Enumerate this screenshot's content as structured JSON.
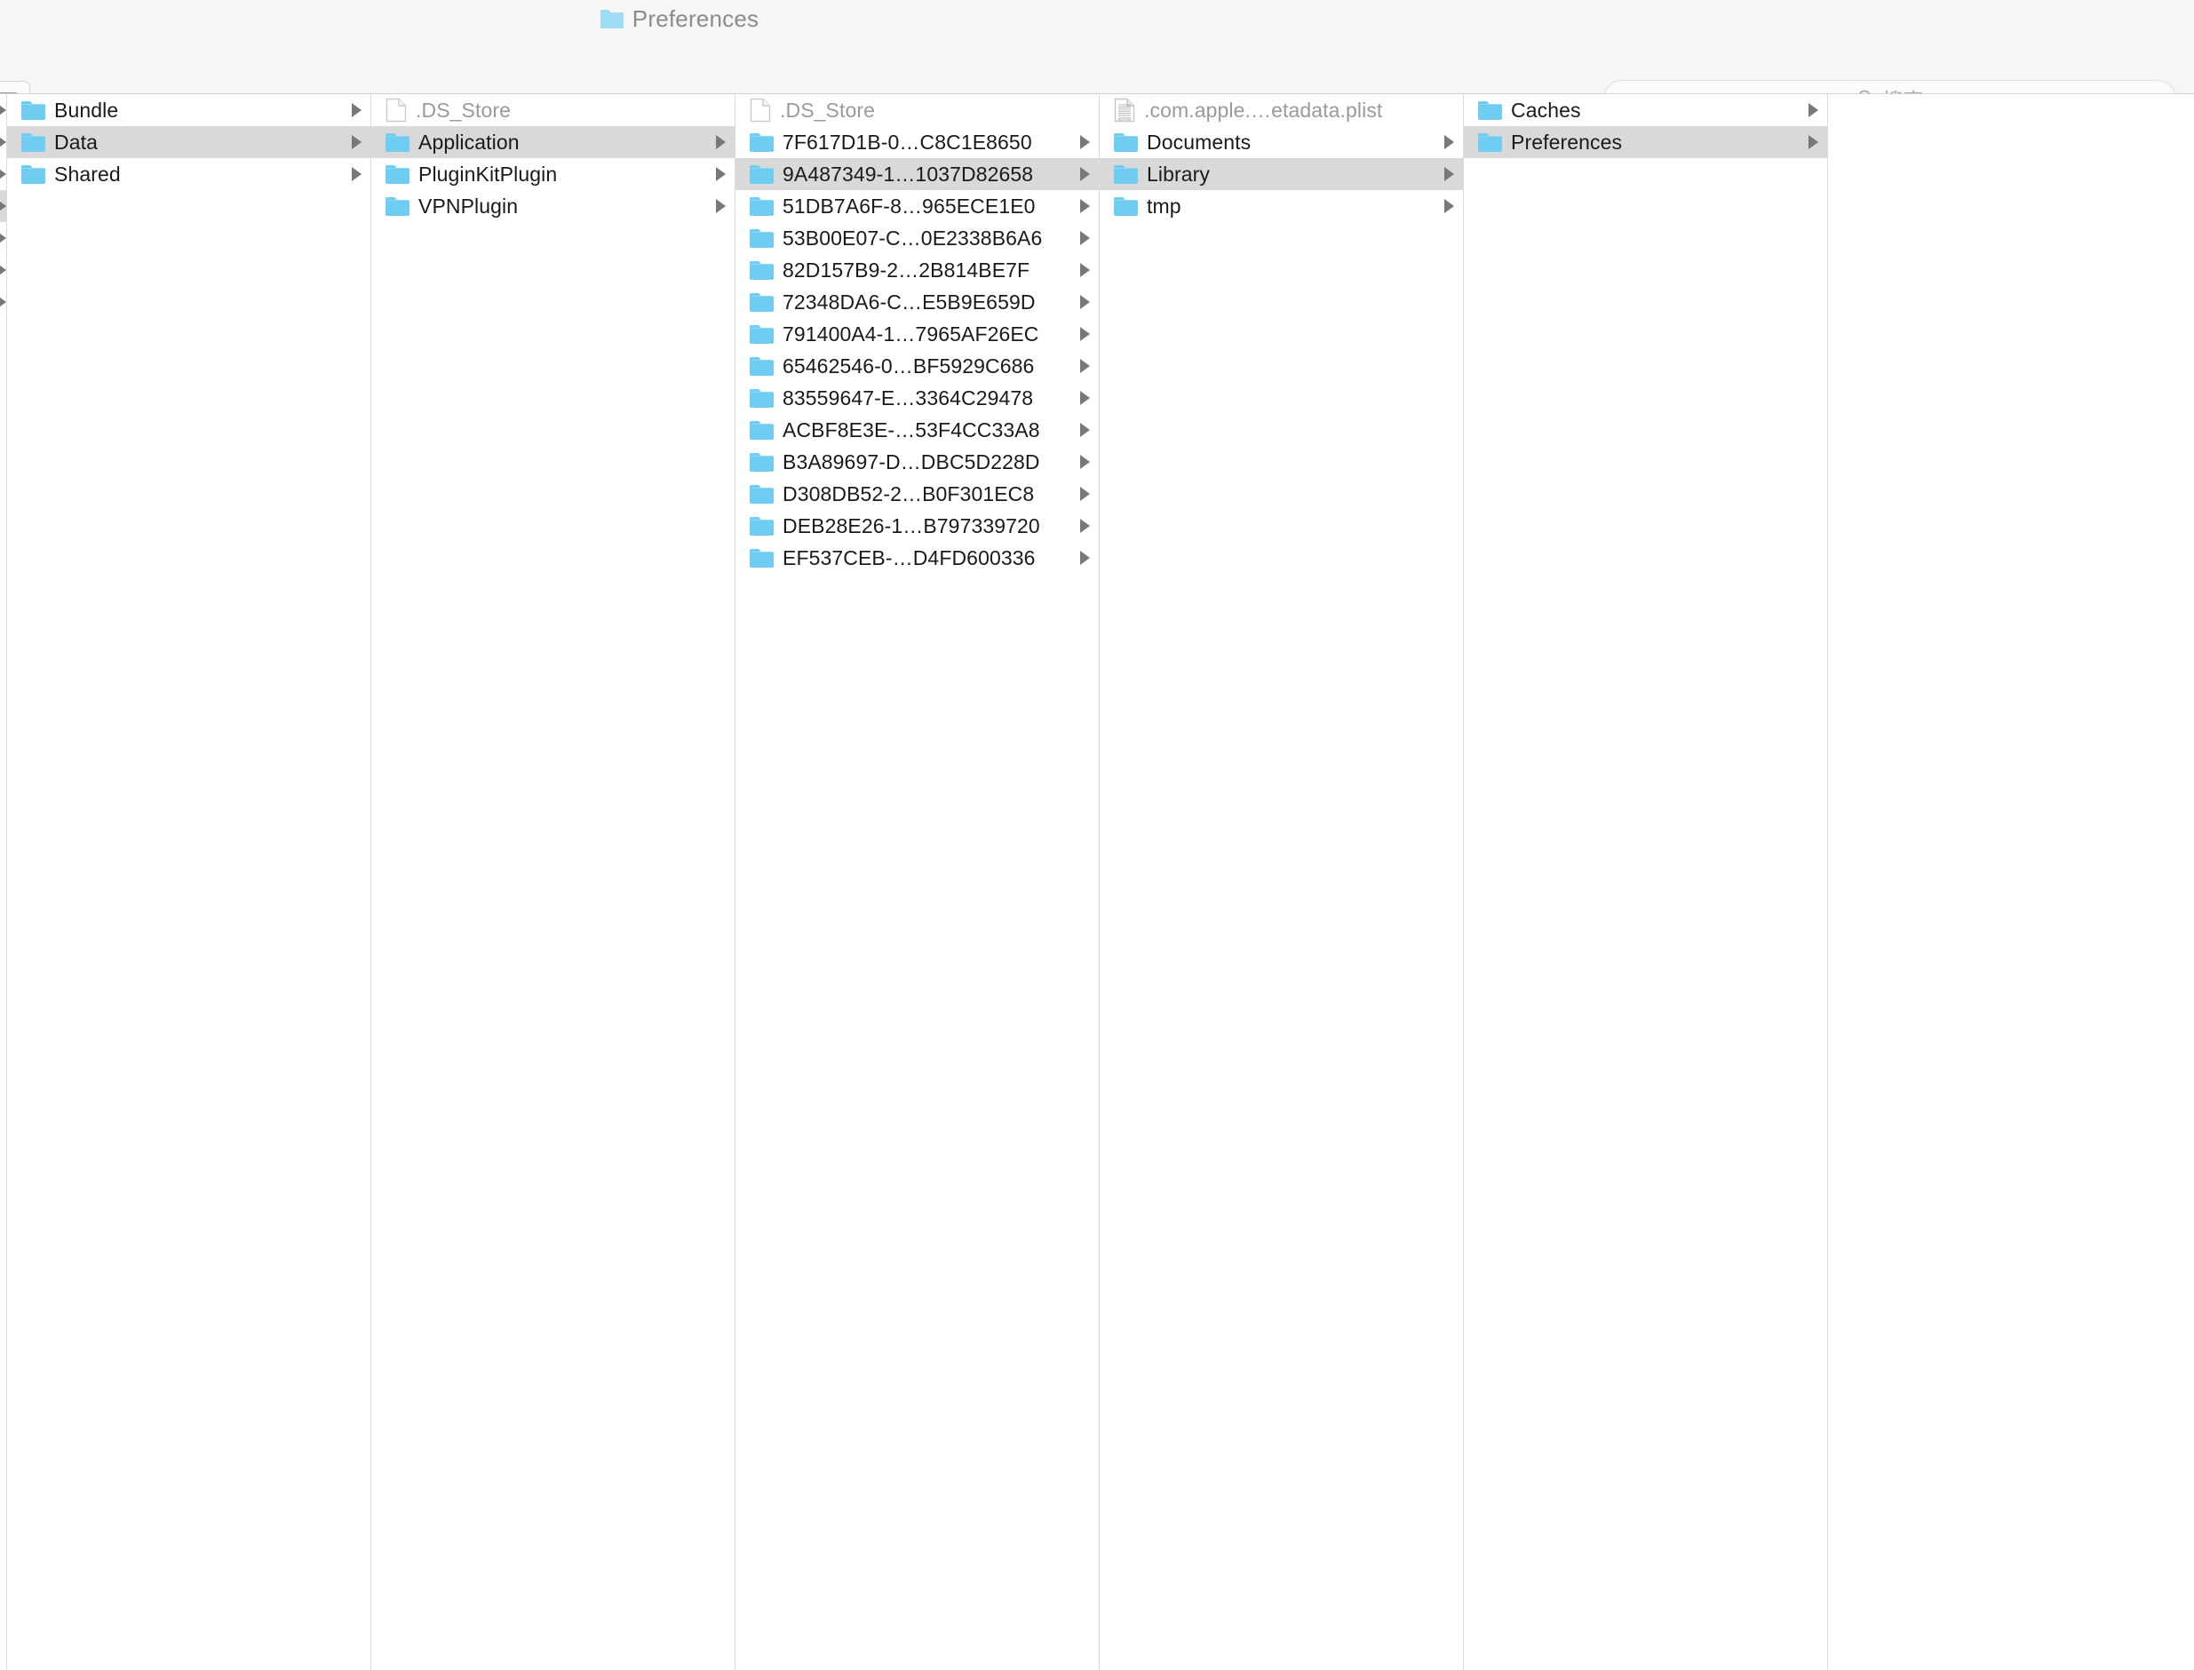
{
  "window": {
    "title": "Preferences",
    "title_icon": "folder-icon"
  },
  "toolbar": {
    "tag_button_icon": "tag-icon",
    "search": {
      "icon": "search-icon",
      "placeholder": "搜索",
      "value": ""
    }
  },
  "colors": {
    "folder_blue": "#6ecdf0",
    "selection_gray": "#d9d9d9",
    "chrome_gray": "#f6f6f6",
    "divider": "#dcdcdc",
    "text": "#1a1a1a",
    "dimmed_text": "#9a9a9a",
    "title_text": "#8c8c8c"
  },
  "columns": [
    {
      "name": "column-sliver",
      "truncated": true,
      "items": [
        {
          "label": "",
          "type": "folder",
          "has_children": true,
          "selected": false
        },
        {
          "label": "",
          "type": "folder",
          "has_children": true,
          "selected": false
        },
        {
          "label": "",
          "type": "folder",
          "has_children": true,
          "selected": false
        },
        {
          "label": "",
          "type": "folder",
          "has_children": true,
          "selected": true
        },
        {
          "label": "",
          "type": "folder",
          "has_children": true,
          "selected": false
        },
        {
          "label": "",
          "type": "folder",
          "has_children": true,
          "selected": false
        },
        {
          "label": "",
          "type": "folder",
          "has_children": true,
          "selected": false
        }
      ]
    },
    {
      "name": "column-1",
      "items": [
        {
          "label": "Bundle",
          "type": "folder",
          "has_children": true,
          "selected": false,
          "dimmed": false
        },
        {
          "label": "Data",
          "type": "folder",
          "has_children": true,
          "selected": true,
          "dimmed": false
        },
        {
          "label": "Shared",
          "type": "folder",
          "has_children": true,
          "selected": false,
          "dimmed": false
        }
      ]
    },
    {
      "name": "column-2",
      "items": [
        {
          "label": ".DS_Store",
          "type": "document",
          "has_children": false,
          "selected": false,
          "dimmed": true
        },
        {
          "label": "Application",
          "type": "folder",
          "has_children": true,
          "selected": true,
          "dimmed": false
        },
        {
          "label": "PluginKitPlugin",
          "type": "folder",
          "has_children": true,
          "selected": false,
          "dimmed": false
        },
        {
          "label": "VPNPlugin",
          "type": "folder",
          "has_children": true,
          "selected": false,
          "dimmed": false
        }
      ]
    },
    {
      "name": "column-3",
      "items": [
        {
          "label": ".DS_Store",
          "type": "document",
          "has_children": false,
          "selected": false,
          "dimmed": true
        },
        {
          "label": "7F617D1B-0…C8C1E8650",
          "type": "folder",
          "has_children": true,
          "selected": false,
          "dimmed": false
        },
        {
          "label": "9A487349-1…1037D82658",
          "type": "folder",
          "has_children": true,
          "selected": true,
          "dimmed": false
        },
        {
          "label": "51DB7A6F-8…965ECE1E0",
          "type": "folder",
          "has_children": true,
          "selected": false,
          "dimmed": false
        },
        {
          "label": "53B00E07-C…0E2338B6A6",
          "type": "folder",
          "has_children": true,
          "selected": false,
          "dimmed": false
        },
        {
          "label": "82D157B9-2…2B814BE7F",
          "type": "folder",
          "has_children": true,
          "selected": false,
          "dimmed": false
        },
        {
          "label": "72348DA6-C…E5B9E659D",
          "type": "folder",
          "has_children": true,
          "selected": false,
          "dimmed": false
        },
        {
          "label": "791400A4-1…7965AF26EC",
          "type": "folder",
          "has_children": true,
          "selected": false,
          "dimmed": false
        },
        {
          "label": "65462546-0…BF5929C686",
          "type": "folder",
          "has_children": true,
          "selected": false,
          "dimmed": false
        },
        {
          "label": "83559647-E…3364C29478",
          "type": "folder",
          "has_children": true,
          "selected": false,
          "dimmed": false
        },
        {
          "label": "ACBF8E3E-…53F4CC33A8",
          "type": "folder",
          "has_children": true,
          "selected": false,
          "dimmed": false
        },
        {
          "label": "B3A89697-D…DBC5D228D",
          "type": "folder",
          "has_children": true,
          "selected": false,
          "dimmed": false
        },
        {
          "label": "D308DB52-2…B0F301EC8",
          "type": "folder",
          "has_children": true,
          "selected": false,
          "dimmed": false
        },
        {
          "label": "DEB28E26-1…B797339720",
          "type": "folder",
          "has_children": true,
          "selected": false,
          "dimmed": false
        },
        {
          "label": "EF537CEB-…D4FD600336",
          "type": "folder",
          "has_children": true,
          "selected": false,
          "dimmed": false
        }
      ]
    },
    {
      "name": "column-4",
      "items": [
        {
          "label": ".com.apple.…etadata.plist",
          "type": "plist",
          "has_children": false,
          "selected": false,
          "dimmed": true
        },
        {
          "label": "Documents",
          "type": "folder",
          "has_children": true,
          "selected": false,
          "dimmed": false
        },
        {
          "label": "Library",
          "type": "folder",
          "has_children": true,
          "selected": true,
          "dimmed": false
        },
        {
          "label": "tmp",
          "type": "folder",
          "has_children": true,
          "selected": false,
          "dimmed": false
        }
      ]
    },
    {
      "name": "column-5",
      "items": [
        {
          "label": "Caches",
          "type": "folder",
          "has_children": true,
          "selected": false,
          "dimmed": false
        },
        {
          "label": "Preferences",
          "type": "folder",
          "has_children": true,
          "selected": true,
          "dimmed": false
        }
      ]
    },
    {
      "name": "column-preview",
      "items": []
    }
  ]
}
